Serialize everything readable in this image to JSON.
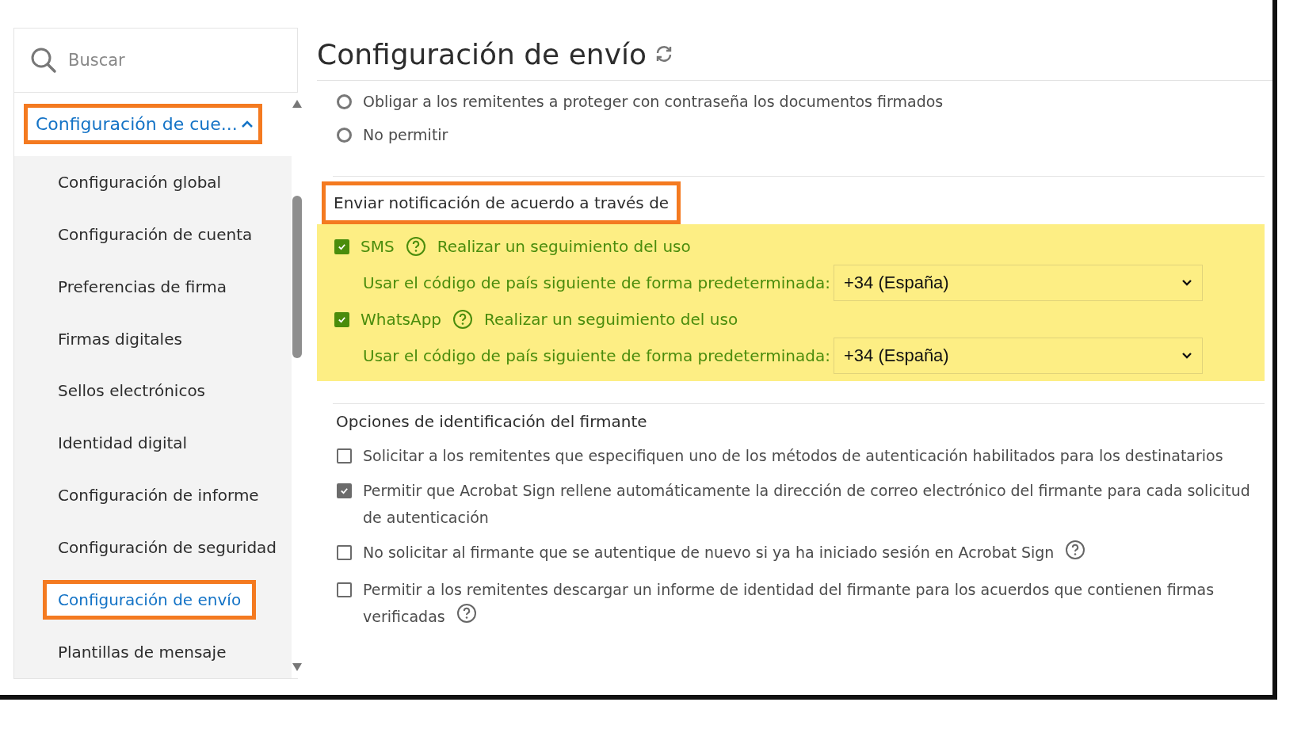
{
  "sidebar": {
    "search": {
      "placeholder": "Buscar"
    },
    "group": {
      "label": "Configuración de cue...",
      "expanded": true,
      "annotated": true
    },
    "items": [
      {
        "label": "Configuración global",
        "selected": false,
        "annotated": false
      },
      {
        "label": "Configuración de cuenta",
        "selected": false,
        "annotated": false
      },
      {
        "label": "Preferencias de firma",
        "selected": false,
        "annotated": false
      },
      {
        "label": "Firmas digitales",
        "selected": false,
        "annotated": false
      },
      {
        "label": "Sellos electrónicos",
        "selected": false,
        "annotated": false
      },
      {
        "label": "Identidad digital",
        "selected": false,
        "annotated": false
      },
      {
        "label": "Configuración de informe",
        "selected": false,
        "annotated": false
      },
      {
        "label": "Configuración de seguridad",
        "selected": false,
        "annotated": false
      },
      {
        "label": "Configuración de envío",
        "selected": true,
        "annotated": true
      },
      {
        "label": "Plantillas de mensaje",
        "selected": false,
        "annotated": false
      }
    ]
  },
  "main": {
    "title": "Configuración de envío",
    "radios": [
      {
        "label": "Obligar a los remitentes a proteger con contraseña los documentos firmados",
        "selected": false
      },
      {
        "label": "No permitir",
        "selected": false
      }
    ],
    "notification": {
      "heading": "Enviar notificación de acuerdo a través de",
      "annotated": true,
      "highlighted": true,
      "channels": [
        {
          "label": "SMS",
          "checked": true,
          "link": "Realizar un seguimiento del uso",
          "code_label": "Usar el código de país siguiente de forma predeterminada:",
          "code_value": "+34 (España)"
        },
        {
          "label": "WhatsApp",
          "checked": true,
          "link": "Realizar un seguimiento del uso",
          "code_label": "Usar el código de país siguiente de forma predeterminada:",
          "code_value": "+34 (España)"
        }
      ]
    },
    "identification": {
      "heading": "Opciones de identificación del firmante",
      "options": [
        {
          "label": "Solicitar a los remitentes que especifiquen uno de los métodos de autenticación habilitados para los destinatarios",
          "checked": false,
          "help": false
        },
        {
          "label": "Permitir que Acrobat Sign rellene automáticamente la dirección de correo electrónico del firmante para cada solicitud de autenticación",
          "checked": true,
          "help": false
        },
        {
          "label": "No solicitar al firmante que se autentique de nuevo si ya ha iniciado sesión en Acrobat Sign",
          "checked": false,
          "help": true
        },
        {
          "label": "Permitir a los remitentes descargar un informe de identidad del firmante para los acuerdos que contienen firmas verificadas",
          "checked": false,
          "help": true
        }
      ]
    }
  }
}
